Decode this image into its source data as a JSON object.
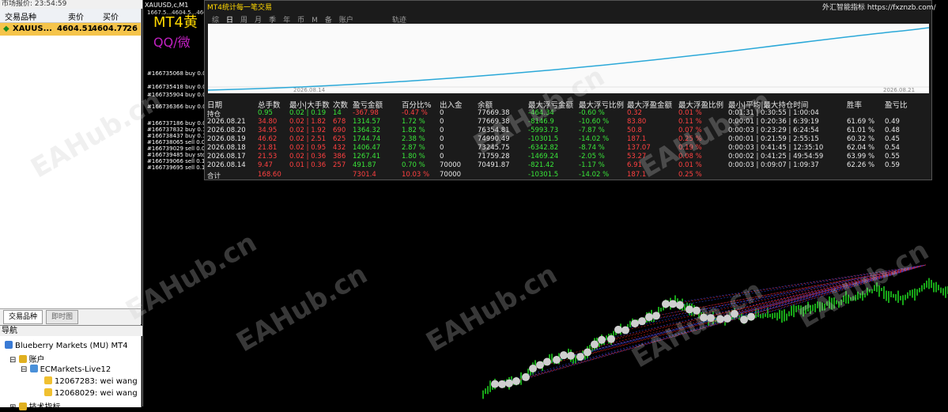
{
  "market_watch": {
    "title": "市场报价: 23:54:59",
    "col_symbol": "交易品种",
    "col_bid": "卖价",
    "col_ask": "买价",
    "row": {
      "symbol": "XAUUS...",
      "bid": "4604.51",
      "ask": "4604.77",
      "spread": "26"
    },
    "tab_symbols": "交易品种",
    "tab_ticks": "即时图"
  },
  "navigator": {
    "title": "导航",
    "broker": "Blueberry Markets (MU) MT4",
    "accounts_label": "账户",
    "server": "ECMarkets-Live12",
    "accounts": [
      "12067283: wei wang",
      "12068029: wei wang"
    ],
    "indicators_label": "技术指标"
  },
  "chart": {
    "symbol": "XAUUSD,c,M1",
    "ohlc": "1667.5...4604.5...4602.93 4605.59 4601.11 4602.89",
    "big_text_1": "MT4黄",
    "big_text_2": "QQ/微",
    "orders": [
      "#166735068 buy 0.02",
      "#166735418 buy 0.02",
      "#166735904 buy 0.04",
      "#166736366 buy 0.02",
      "#166737186 buy 0.02",
      "#166737832 buy 0.10",
      "#166738437 buy 0.10",
      "#166738065 sell 0.03",
      "#166739029 sell 0.02",
      "#166739485 buy stop",
      "#166739066 sell 0.10",
      "#166739695 sell 0.10"
    ]
  },
  "panel": {
    "title": "MT4统计每一笔交易",
    "link": "外汇智能指标 https://fxznzb.com/",
    "tabs": [
      "综",
      "日",
      "周",
      "月",
      "季",
      "年",
      "币",
      "M",
      "备",
      "账户"
    ],
    "active_tab": "日",
    "track_label": "轨迹",
    "date_left": "2026.08.14",
    "date_right": "2026.08.21",
    "headers": [
      "日期",
      "总手数",
      "最小|大手数",
      "次数",
      "盈亏金额",
      "百分比%",
      "出入金",
      "余额",
      "最大浮亏金额",
      "最大浮亏比例",
      "最大浮盈金额",
      "最大浮盈比例",
      "最小|平均|最大持仓时间",
      "胜率",
      "盈亏比"
    ],
    "rows": [
      [
        "持仓",
        "0.95",
        "0.02 | 0.19",
        "14",
        "-367.98",
        "-0.47 %",
        "0",
        "77669.38",
        "-464.34",
        "-0.60 %",
        "0.32",
        "0.01 %",
        "0:01:31 | 0:30:55 | 1:00:04",
        "",
        ""
      ],
      [
        "2026.08.21",
        "34.80",
        "0.02 | 1.82",
        "678",
        "1314.57",
        "1.72 %",
        "0",
        "77669.38",
        "-8146.9",
        "-10.60 %",
        "83.80",
        "0.11 %",
        "0:00:01 | 0:20:36 | 6:39:19",
        "61.69 %",
        "0.49"
      ],
      [
        "2026.08.20",
        "34.95",
        "0.02 | 1.92",
        "690",
        "1364.32",
        "1.82 %",
        "0",
        "76354.81",
        "-5993.73",
        "-7.87 %",
        "50.8",
        "0.07 %",
        "0:00:03 | 0:23:29 | 6:24:54",
        "61.01 %",
        "0.48"
      ],
      [
        "2026.08.19",
        "46.62",
        "0.02 | 2.51",
        "625",
        "1744.74",
        "2.38 %",
        "0",
        "74990.49",
        "-10301.5",
        "-14.02 %",
        "187.1",
        "0.25 %",
        "0:00:01 | 0:21:59 | 2:55:15",
        "60.32 %",
        "0.45"
      ],
      [
        "2026.08.18",
        "21.81",
        "0.02 | 0.95",
        "432",
        "1406.47",
        "2.87 %",
        "0",
        "73245.75",
        "-6342.82",
        "-8.74 %",
        "137.07",
        "0.19 %",
        "0:00:03 | 0:41:45 | 12:35:10",
        "62.04 %",
        "0.54"
      ],
      [
        "2026.08.17",
        "21.53",
        "0.02 | 0.36",
        "386",
        "1267.41",
        "1.80 %",
        "0",
        "71759.28",
        "-1469.24",
        "-2.05 %",
        "53.27",
        "0.08 %",
        "0:00:02 | 0:41:25 | 49:54:59",
        "63.99 %",
        "0.55"
      ],
      [
        "2026.08.14",
        "9.47",
        "0.01 | 0.36",
        "257",
        "491.87",
        "0.70 %",
        "70000",
        "70491.87",
        "-821.42",
        "-1.17 %",
        "6.91",
        "0.01 %",
        "0:00:03 | 0:09:07 | 1:09:37",
        "62.26 %",
        "0.59"
      ]
    ],
    "total": [
      "合计",
      "168.60",
      "",
      "",
      "7301.4",
      "10.03 %",
      "70000",
      "",
      "-10301.5",
      "-14.02 %",
      "187.1",
      "0.25 %",
      "",
      "",
      ""
    ]
  },
  "watermark": "EAHub.cn",
  "colors": {
    "panel_bg": "#1b1b1b",
    "profit": "#39e639",
    "loss": "#ff4040",
    "equity_line": "#2aa8d8",
    "candles": "#1fd11f"
  }
}
